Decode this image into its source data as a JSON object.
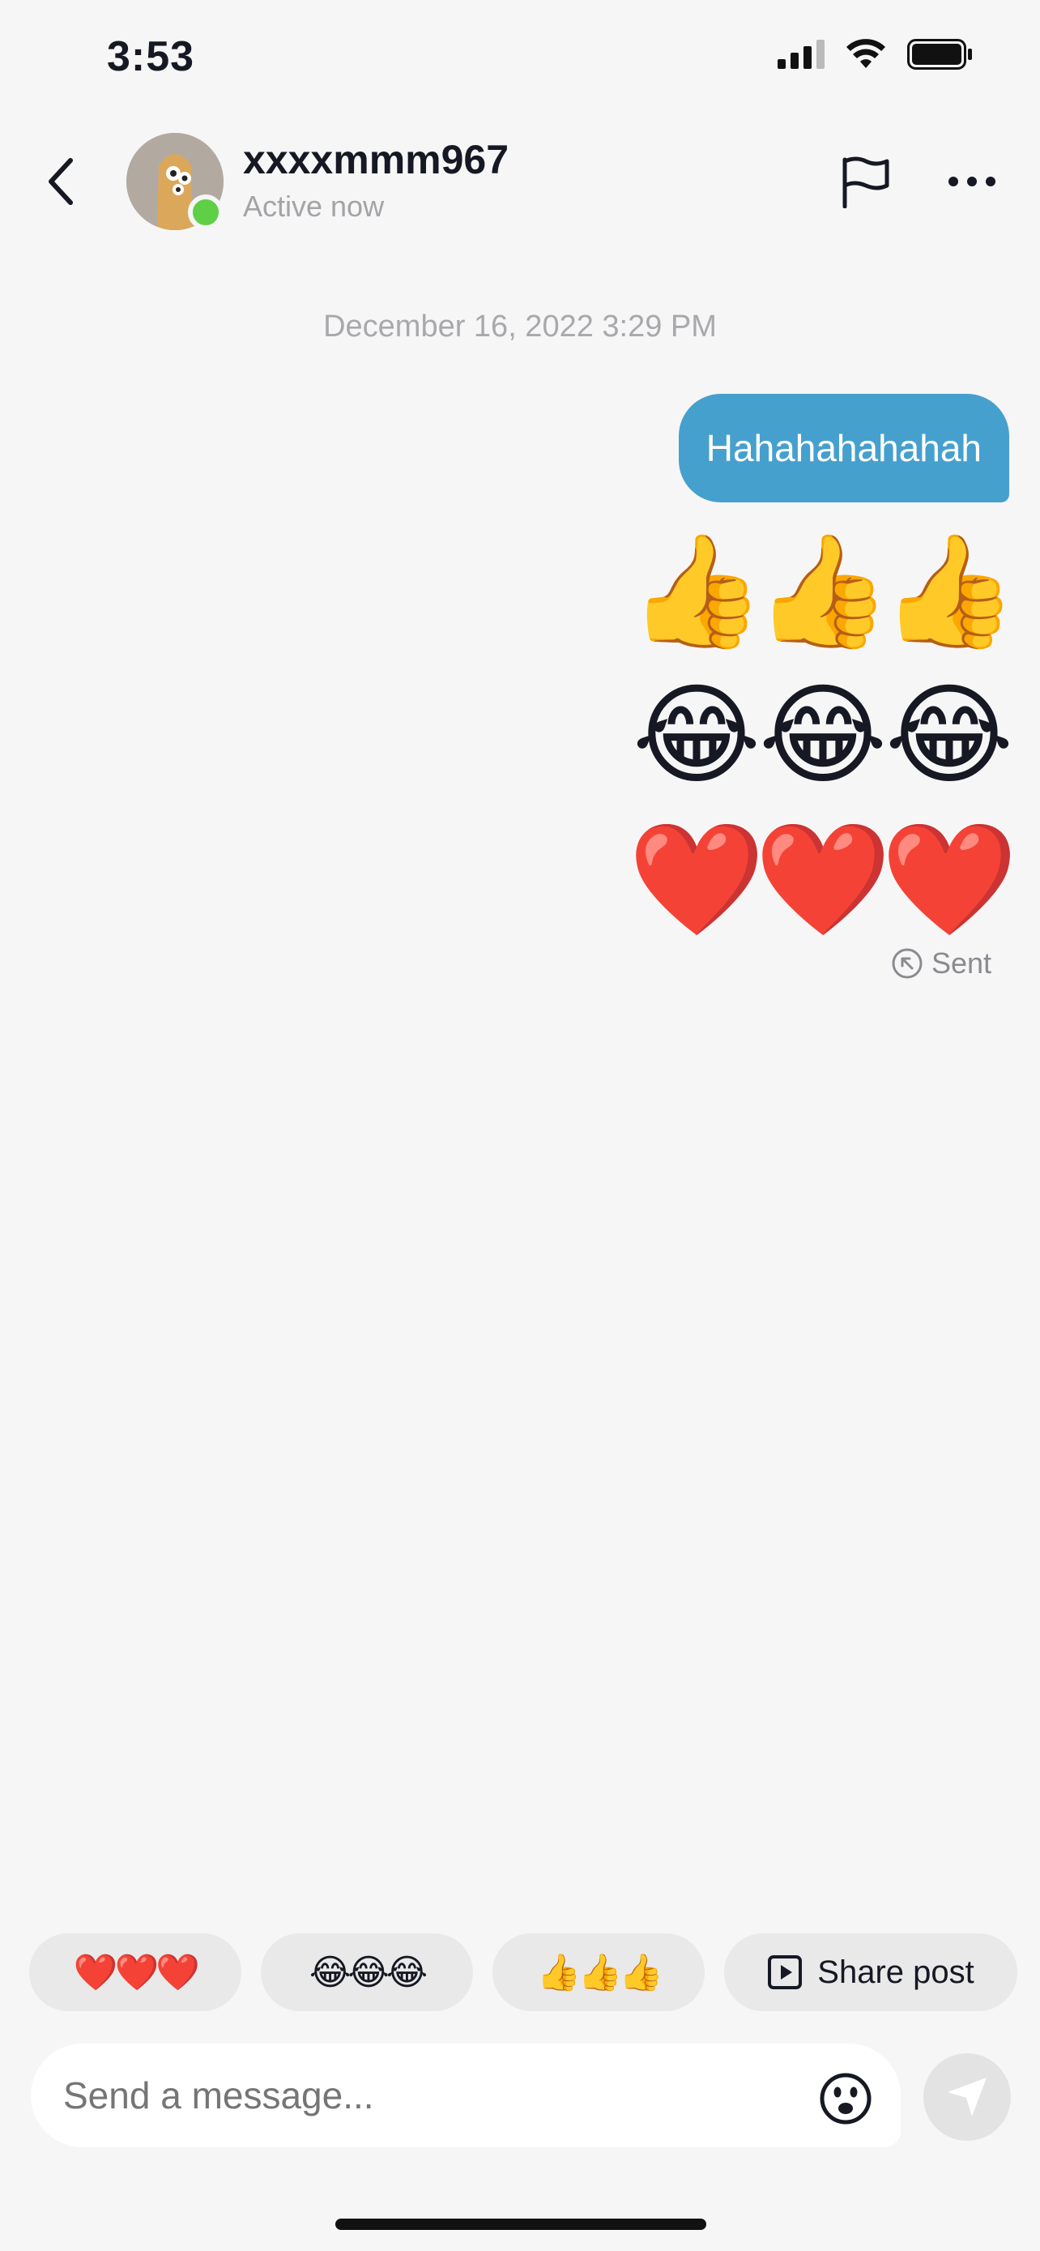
{
  "status_bar": {
    "time": "3:53"
  },
  "header": {
    "username": "xxxxmmm967",
    "status": "Active now"
  },
  "conversation": {
    "date": "December 16, 2022 3:29 PM",
    "messages": [
      {
        "text": "Hahahahahahah"
      }
    ],
    "emoji_rows": [
      [
        "👍",
        "👍",
        "👍"
      ],
      [
        "😂",
        "😂",
        "😂"
      ],
      [
        "❤️",
        "❤️",
        "❤️"
      ]
    ],
    "sent_label": "Sent"
  },
  "quick_replies": [
    {
      "text": "❤️❤️❤️"
    },
    {
      "text": "😂😂😂"
    },
    {
      "text": "👍👍👍"
    }
  ],
  "share_post_label": "Share post",
  "composer": {
    "placeholder": "Send a message..."
  },
  "colors": {
    "bubble": "#46a0cd",
    "online": "#5fcf45",
    "background": "#f6f6f6"
  }
}
